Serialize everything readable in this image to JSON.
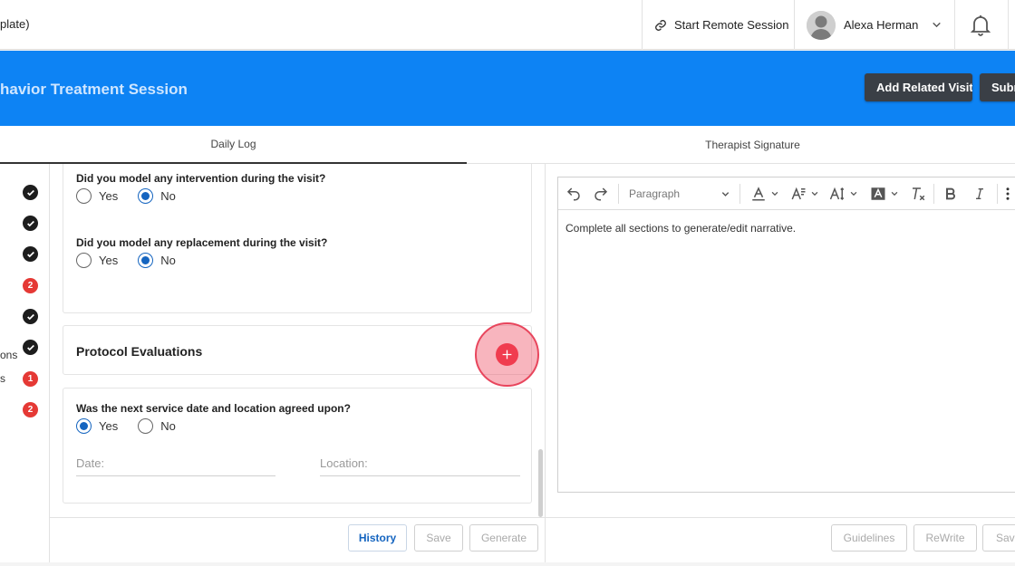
{
  "header": {
    "breadcrumb_fragment": "plate)",
    "remote_session_label": "Start Remote Session",
    "user_name": "Alexa Herman"
  },
  "titlebar": {
    "title": "havior Treatment Session",
    "add_related_visit_label": "Add Related Visit",
    "submit_label": "Subm"
  },
  "tabs": [
    {
      "label": "Daily Log",
      "active": true
    },
    {
      "label": "Therapist Signature",
      "active": false
    }
  ],
  "rail": {
    "items": [
      {
        "type": "check"
      },
      {
        "type": "check"
      },
      {
        "type": "check"
      },
      {
        "type": "badge",
        "count": "2"
      },
      {
        "type": "check"
      },
      {
        "type": "check",
        "text_fragment": "ons"
      },
      {
        "type": "badge",
        "count": "1",
        "text_fragment": "s"
      },
      {
        "type": "badge",
        "count": "2"
      }
    ]
  },
  "form": {
    "q1": {
      "question": "Did you model any intervention during the visit?",
      "yes": "Yes",
      "no": "No",
      "selected": "No"
    },
    "q2": {
      "question": "Did you model any replacement during the visit?",
      "yes": "Yes",
      "no": "No",
      "selected": "No"
    },
    "protocol_title": "Protocol Evaluations",
    "q3": {
      "question": "Was the next service date and location agreed upon?",
      "yes": "Yes",
      "no": "No",
      "selected": "Yes"
    },
    "date_placeholder": "Date:",
    "location_placeholder": "Location:"
  },
  "form_buttons": {
    "history": "History",
    "save": "Save",
    "generate": "Generate"
  },
  "editor": {
    "paragraph_format": "Paragraph",
    "content": "Complete all sections to generate/edit narrative."
  },
  "editor_buttons": {
    "guidelines": "Guidelines",
    "rewrite": "ReWrite",
    "save": "Save"
  },
  "colors": {
    "accent": "#0d83f4",
    "dark_button": "#3a3f46",
    "badge_red": "#e53935",
    "fab_red": "#f03c4f",
    "radio_blue": "#1565c0"
  }
}
